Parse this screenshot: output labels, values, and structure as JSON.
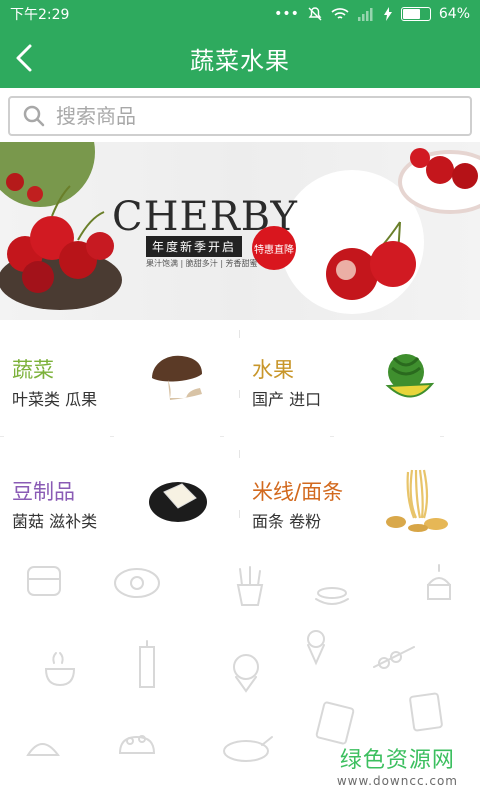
{
  "status_bar": {
    "time": "下午2:29",
    "battery": "64%"
  },
  "header": {
    "title": "蔬菜水果"
  },
  "search": {
    "placeholder": "搜索商品"
  },
  "banner": {
    "headline": "CHERBY",
    "tagline": "年度新季开启",
    "badge": "特惠直降",
    "features": "果汁饱满 | 脆甜多汁 | 芳香甜蜜"
  },
  "categories": [
    {
      "name": "蔬菜",
      "sub": "叶菜类  瓜果",
      "color": "#7cb13a",
      "icon": "mushroom-icon"
    },
    {
      "name": "水果",
      "sub": "国产  进口",
      "color": "#c8962a",
      "icon": "watermelon-icon"
    },
    {
      "name": "豆制品",
      "sub": "菌菇  滋补类",
      "color": "#8a5bb5",
      "icon": "tofu-icon"
    },
    {
      "name": "米线/面条",
      "sub": "面条  卷粉",
      "color": "#d2691e",
      "icon": "noodles-icon"
    }
  ],
  "watermark": {
    "title": "绿色资源网",
    "url": "www.downcc.com"
  },
  "colors": {
    "brand_green": "#2eaa5e"
  }
}
